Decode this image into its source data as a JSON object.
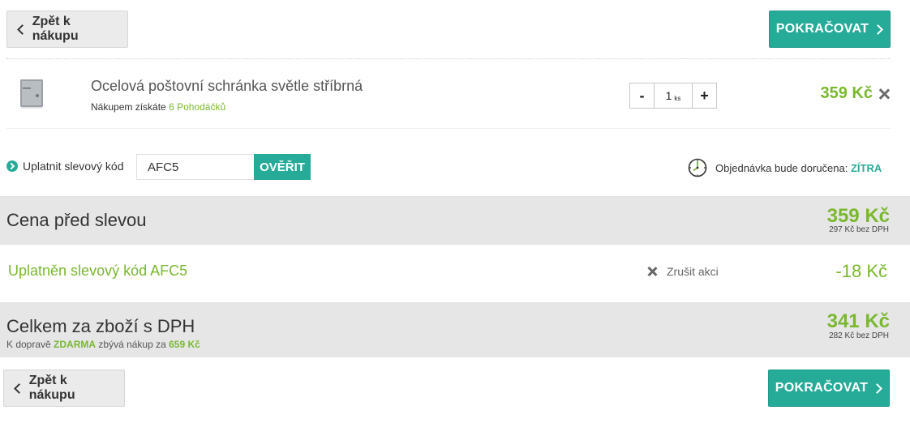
{
  "nav": {
    "back_label": "Zpět k nákupu",
    "continue_label": "POKRAČOVAT"
  },
  "cart_item": {
    "name": "Ocelová poštovní schránka světle stříbrná",
    "points_prefix": "Nákupem získáte",
    "points_value": "6 Pohodáčků",
    "quantity": "1",
    "unit": "ks",
    "minus_label": "-",
    "plus_label": "+",
    "price": "359 Kč",
    "image_icon": "mailbox-thumbnail"
  },
  "promo": {
    "label": "Uplatnit slevový kód",
    "code_value": "AFC5",
    "verify_label": "OVĚŘIT"
  },
  "delivery": {
    "label": "Objednávka bude doručena:",
    "day": "ZÍTRA",
    "icon": "clock-icon"
  },
  "summary": {
    "before_discount_label": "Cena před slevou",
    "before_discount_price": "359 Kč",
    "before_discount_net": "297 Kč bez DPH",
    "discount_label": "Uplatněn slevový kód AFC5",
    "discount_cancel": "Zrušit akci",
    "discount_amount": "-18 Kč",
    "total_label": "Celkem za zboží s DPH",
    "total_price": "341 Kč",
    "total_net": "282 Kč bez DPH",
    "shipping_prefix": "K dopravě",
    "shipping_free": "ZDARMA",
    "shipping_middle": "zbývá nákup za",
    "shipping_remaining": "659 Kč"
  },
  "colors": {
    "accent_teal": "#26ab98",
    "price_green": "#7ab82f",
    "band_gray": "#e6e6e6"
  }
}
